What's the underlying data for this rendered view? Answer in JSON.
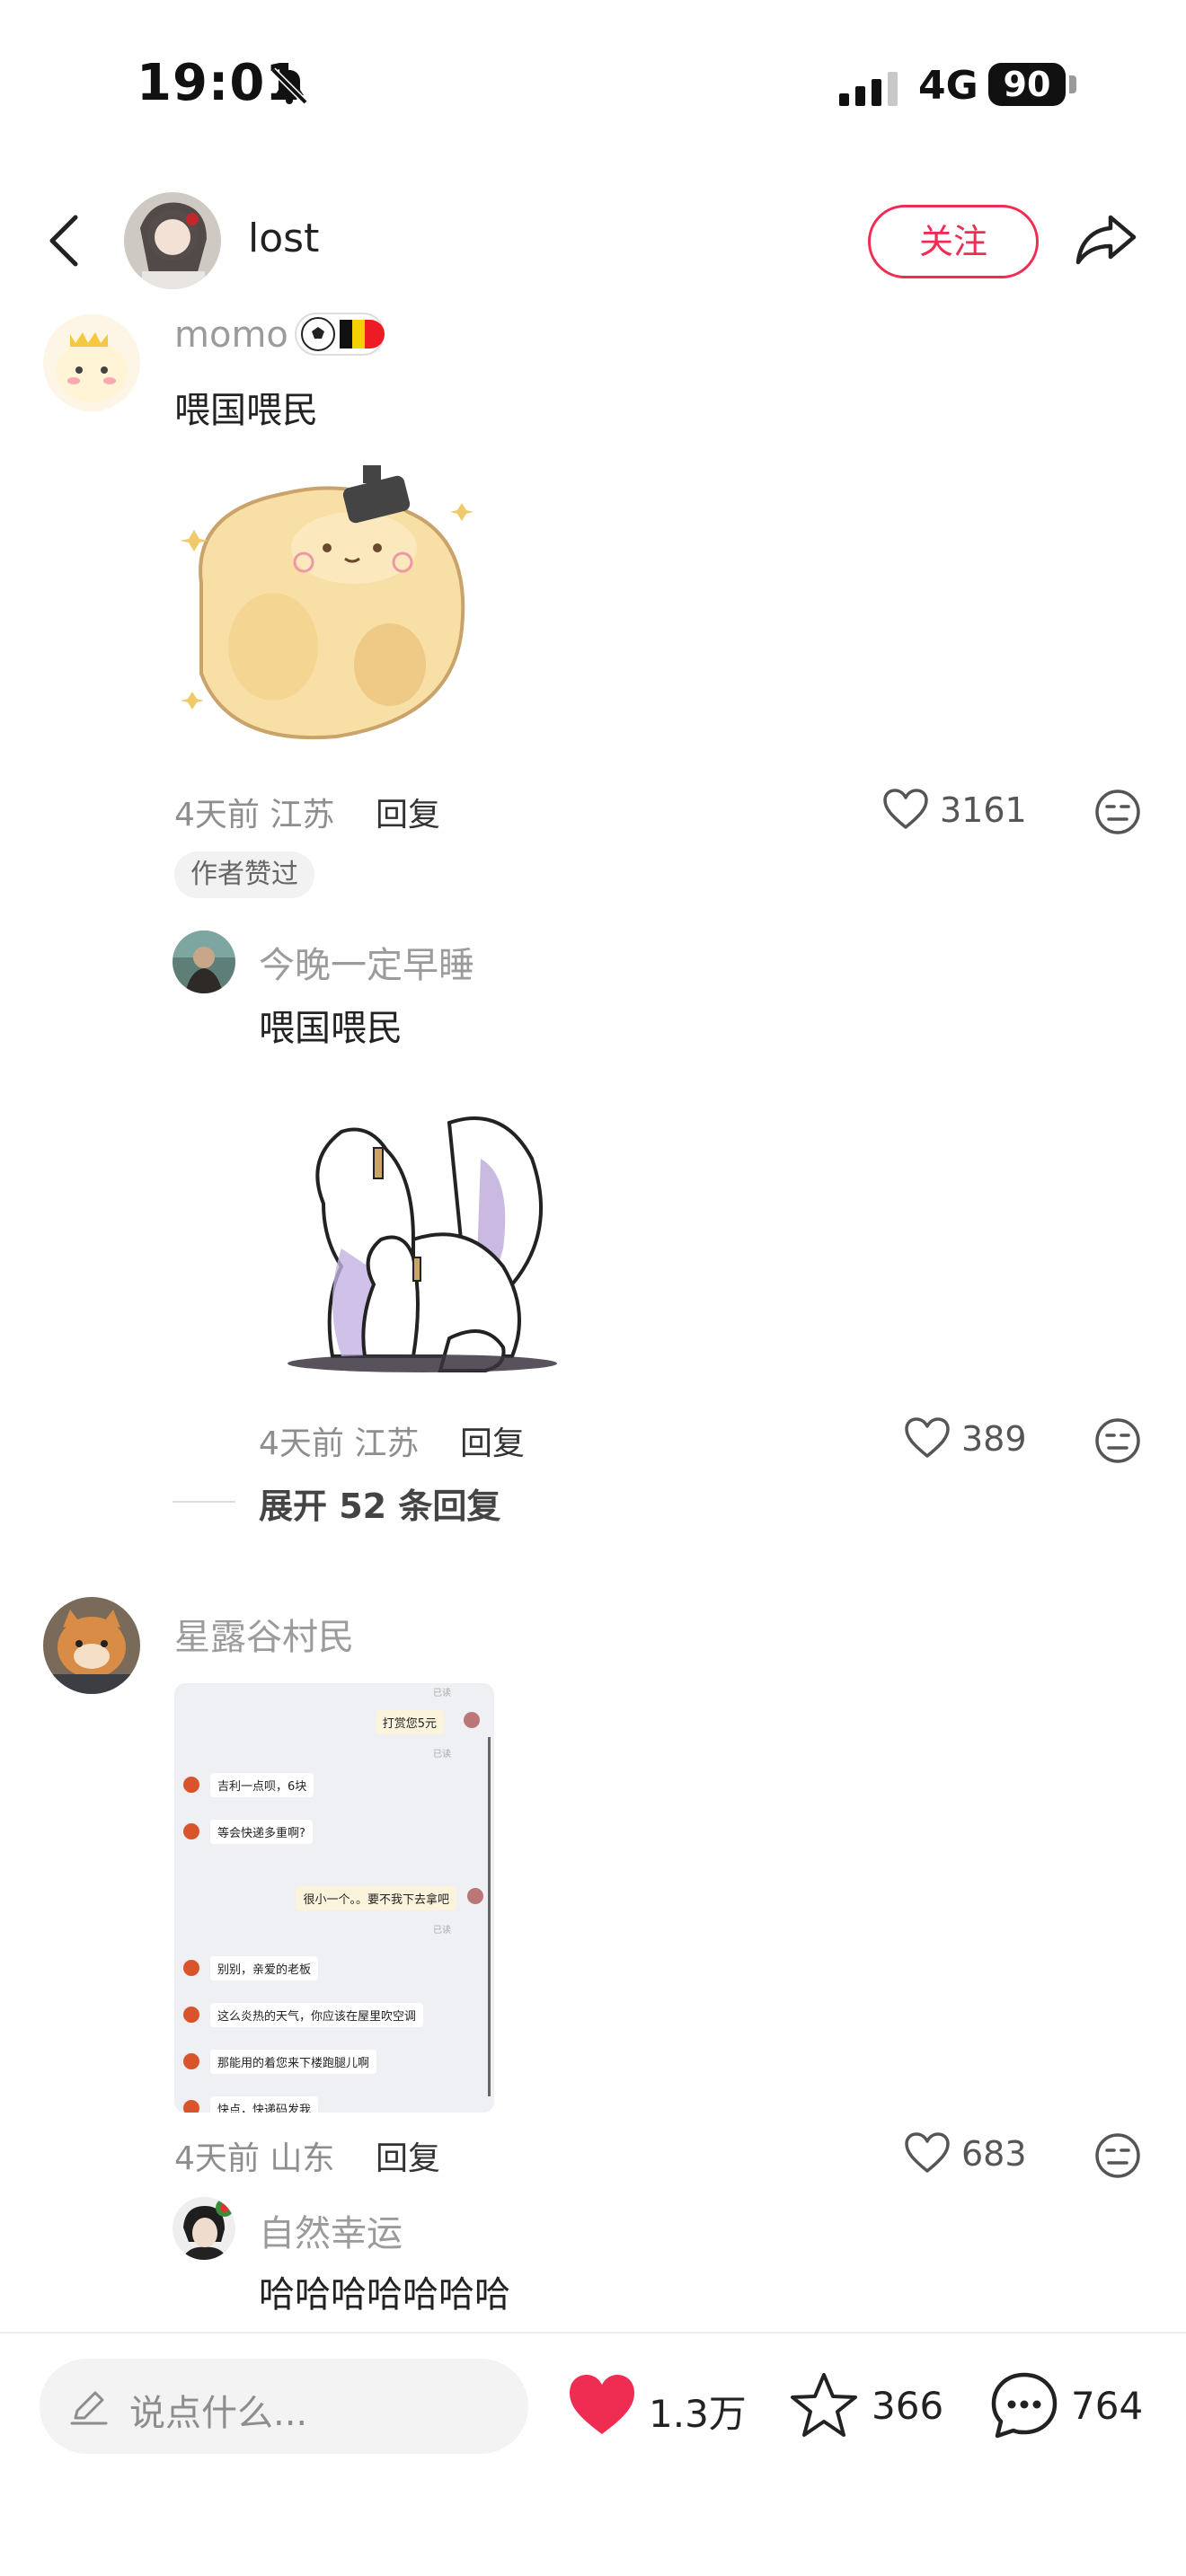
{
  "status_bar": {
    "time": "19:01",
    "network": "4G",
    "battery": "90"
  },
  "nav": {
    "username": "lost",
    "follow_label": "关注"
  },
  "comments": [
    {
      "user": "momo",
      "text": "喂国喂民",
      "time_location": "4天前 江苏",
      "reply_label": "回复",
      "likes": "3161",
      "badge": "作者赞过",
      "sub_reply": {
        "user": "今晚一定早睡",
        "text": "喂国喂民",
        "time_location": "4天前 江苏",
        "reply_label": "回复",
        "likes": "389"
      },
      "expand_label": "展开 52 条回复"
    },
    {
      "user": "星露谷村民",
      "time_location": "4天前 山东",
      "reply_label": "回复",
      "likes": "683",
      "chat_image": {
        "read": "已读",
        "messages": [
          "打赏您5元",
          "吉利一点呗，6块",
          "等会快递多重啊?",
          "很小一个。。要不我下去拿吧",
          "别别，亲爱的老板",
          "这么炎热的天气，你应该在屋里吹空调",
          "那能用的着您来下楼跑腿儿啊",
          "快点，快递码发我"
        ]
      },
      "sub_reply": {
        "user": "自然幸运",
        "text": "哈哈哈哈哈哈哈"
      }
    }
  ],
  "bottom_bar": {
    "input_placeholder": "说点什么...",
    "likes": "1.3万",
    "favorites": "366",
    "comments": "764"
  },
  "colors": {
    "accent": "#ef2d52",
    "muted": "#9b9b9b"
  }
}
